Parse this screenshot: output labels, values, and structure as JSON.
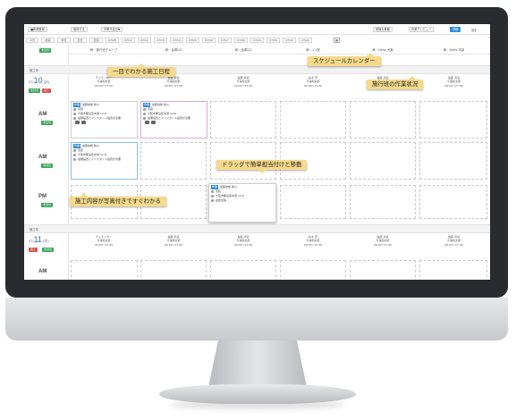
{
  "topbar": {
    "new_button": "■新規登録",
    "fetch_button": "取得する",
    "filter_select": "作業予定日▼",
    "right_btn1": "現場を移動",
    "right_btn2": "作業プレビュー",
    "right_btn3": "詳細",
    "right_text": "設定"
  },
  "dates": [
    "今日",
    "前週",
    "前日",
    "翌日",
    "翌週",
    "07/08",
    "07/11",
    "07/12",
    "07/13",
    "07/14",
    "07/15",
    "07/16",
    "07/17",
    "07/18",
    "07/19",
    "07/20",
    "07/21",
    "07/22"
  ],
  "columns": [
    "㈱・施行班グループ",
    "㈱・倉庫G3",
    "㈱・倉庫G3",
    "㈱・1 1班",
    "㈱・Hello 大阪",
    "㈱・Hello 本部"
  ],
  "left": {
    "unassigned_chip": "未割当",
    "band1_label": "施工中",
    "band2_label": "施工中",
    "day1": "10",
    "day1_prefix": "07/",
    "day1_weekday": "(水)",
    "day2": "11",
    "day2_prefix": "07/",
    "day2_weekday": "(木)",
    "am": "AM",
    "pm": "PM",
    "chip_green": "未割当",
    "chip_red": "完了"
  },
  "members": [
    [
      "チャランポー",
      "平澤和太郎",
      "09:00〜17:00"
    ],
    [
      "佐藤 清道",
      "平澤和太郎",
      "09:00〜17:00"
    ],
    [
      "佐藤 清道",
      "平澤和太郎",
      "09:00〜17:00"
    ],
    [
      "鈴木 茂",
      "平澤和太郎",
      "09:00〜17:00"
    ],
    [
      "佐藤 清道",
      "平澤和太郎",
      "09:00〜17:00"
    ],
    [
      "佐藤 清道",
      "平澤和太郎",
      "09:00〜17:00"
    ]
  ],
  "cards": {
    "c1": {
      "tag": "作業",
      "title": "加藤技術 新川",
      "l2": "塗装",
      "l3": "大阪市都島区中通 12-8",
      "l4": "設備設置とインスタント設置が必要"
    },
    "c2": {
      "tag": "作業",
      "title": "加藤技術 新川",
      "l2": "塗装",
      "l3": "大阪市都島区中通 12-8",
      "l4": "設備設置とインスタント設置が必要"
    },
    "c3": {
      "tag": "作業",
      "title": "加藤技術 新川",
      "l2": "塗装",
      "l3": "大阪市都島区中通 12-8",
      "l4": "設備設置とインスタント設置が必要"
    },
    "c4": {
      "tag": "作業",
      "title": "加藤技術 新川",
      "l2": "塗装",
      "l3": "大阪市都島区中通 12-8",
      "l4": "最新出張"
    }
  },
  "callouts": {
    "schedule": "一目でわかる施工日程",
    "calendar": "スケジュールカレンダー",
    "status": "施行班の作業状況",
    "drag": "ドラッグで簡単担当付けと移動",
    "photo": "施工内容が写真付きですぐわかる"
  },
  "colors": {
    "callout": "#f6d98a",
    "accent_blue": "#2d8ad8",
    "green_chip": "#3aa55a",
    "red_chip": "#d9534f",
    "bezel": "#2a2b2e"
  }
}
